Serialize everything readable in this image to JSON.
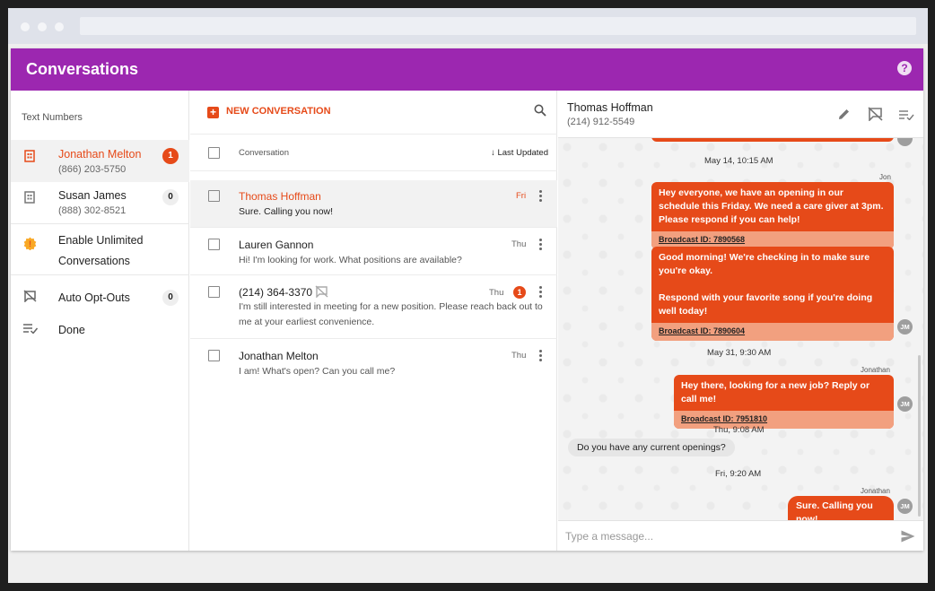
{
  "app": {
    "title": "Conversations",
    "help_icon": "help-icon"
  },
  "sidebar": {
    "heading": "Text Numbers",
    "numbers": [
      {
        "name": "Jonathan Melton",
        "phone": "(866) 203-5750",
        "badge": "1",
        "icon": "building-icon"
      },
      {
        "name": "Susan James",
        "phone": "(888) 302-8521",
        "badge": "0",
        "icon": "building-icon"
      }
    ],
    "unlimited": {
      "line1": "Enable Unlimited",
      "line2": "Conversations",
      "icon": "warning-badge-icon"
    },
    "opt_outs": {
      "label": "Auto Opt-Outs",
      "badge": "0",
      "icon": "message-off-icon"
    },
    "done": {
      "label": "Done",
      "icon": "playlist-check-icon"
    }
  },
  "list": {
    "new_label": "NEW CONVERSATION",
    "col_label": "Conversation",
    "sort_label": "Last Updated",
    "conversations": [
      {
        "name": "Thomas Hoffman",
        "msg": "Sure. Calling you now!",
        "day": "Fri"
      },
      {
        "name": "Lauren Gannon",
        "msg": "Hi! I'm looking for work. What positions are available?",
        "day": "Thu"
      },
      {
        "name": "(214) 364-3370",
        "msg": "I'm still interested in meeting for a new position. Please reach back out to me at your earliest convenience.",
        "day": "Thu",
        "badge": "1"
      },
      {
        "name": "Jonathan Melton",
        "msg": "I am! What's open? Can you call me?",
        "day": "Thu"
      }
    ]
  },
  "chat": {
    "contact_name": "Thomas Hoffman",
    "contact_phone": "(214) 912-5549",
    "stamps": [
      "May 14, 10:15 AM",
      "May 31, 9:30 AM",
      "Thu, 9:08 AM",
      "Fri, 9:20 AM"
    ],
    "messages": [
      {
        "sender": "Jon",
        "text": "Hey everyone, we have an opening in our schedule this Friday. We need a care giver at 3pm.\nPlease respond if you can help!",
        "broadcast": "Broadcast ID: 7890568"
      },
      {
        "text": "Good morning! We're checking in to make sure you're okay.\n\nRespond with your favorite song if you're doing well today!",
        "broadcast": "Broadcast ID: 7890604",
        "avatar": "JM"
      },
      {
        "sender": "Jonathan",
        "text": "Hey there, looking for a new job? Reply or call me!",
        "broadcast": "Broadcast ID: 7951810",
        "avatar": "JM"
      },
      {
        "text": "Do you have any current openings?"
      },
      {
        "sender": "Jonathan",
        "text": "Sure. Calling you now!",
        "avatar": "JM"
      }
    ],
    "composer_placeholder": "Type a message..."
  },
  "colors": {
    "purple": "#9c27b0",
    "orange": "#e64a19",
    "broadcast_bg": "#f2a07f"
  }
}
